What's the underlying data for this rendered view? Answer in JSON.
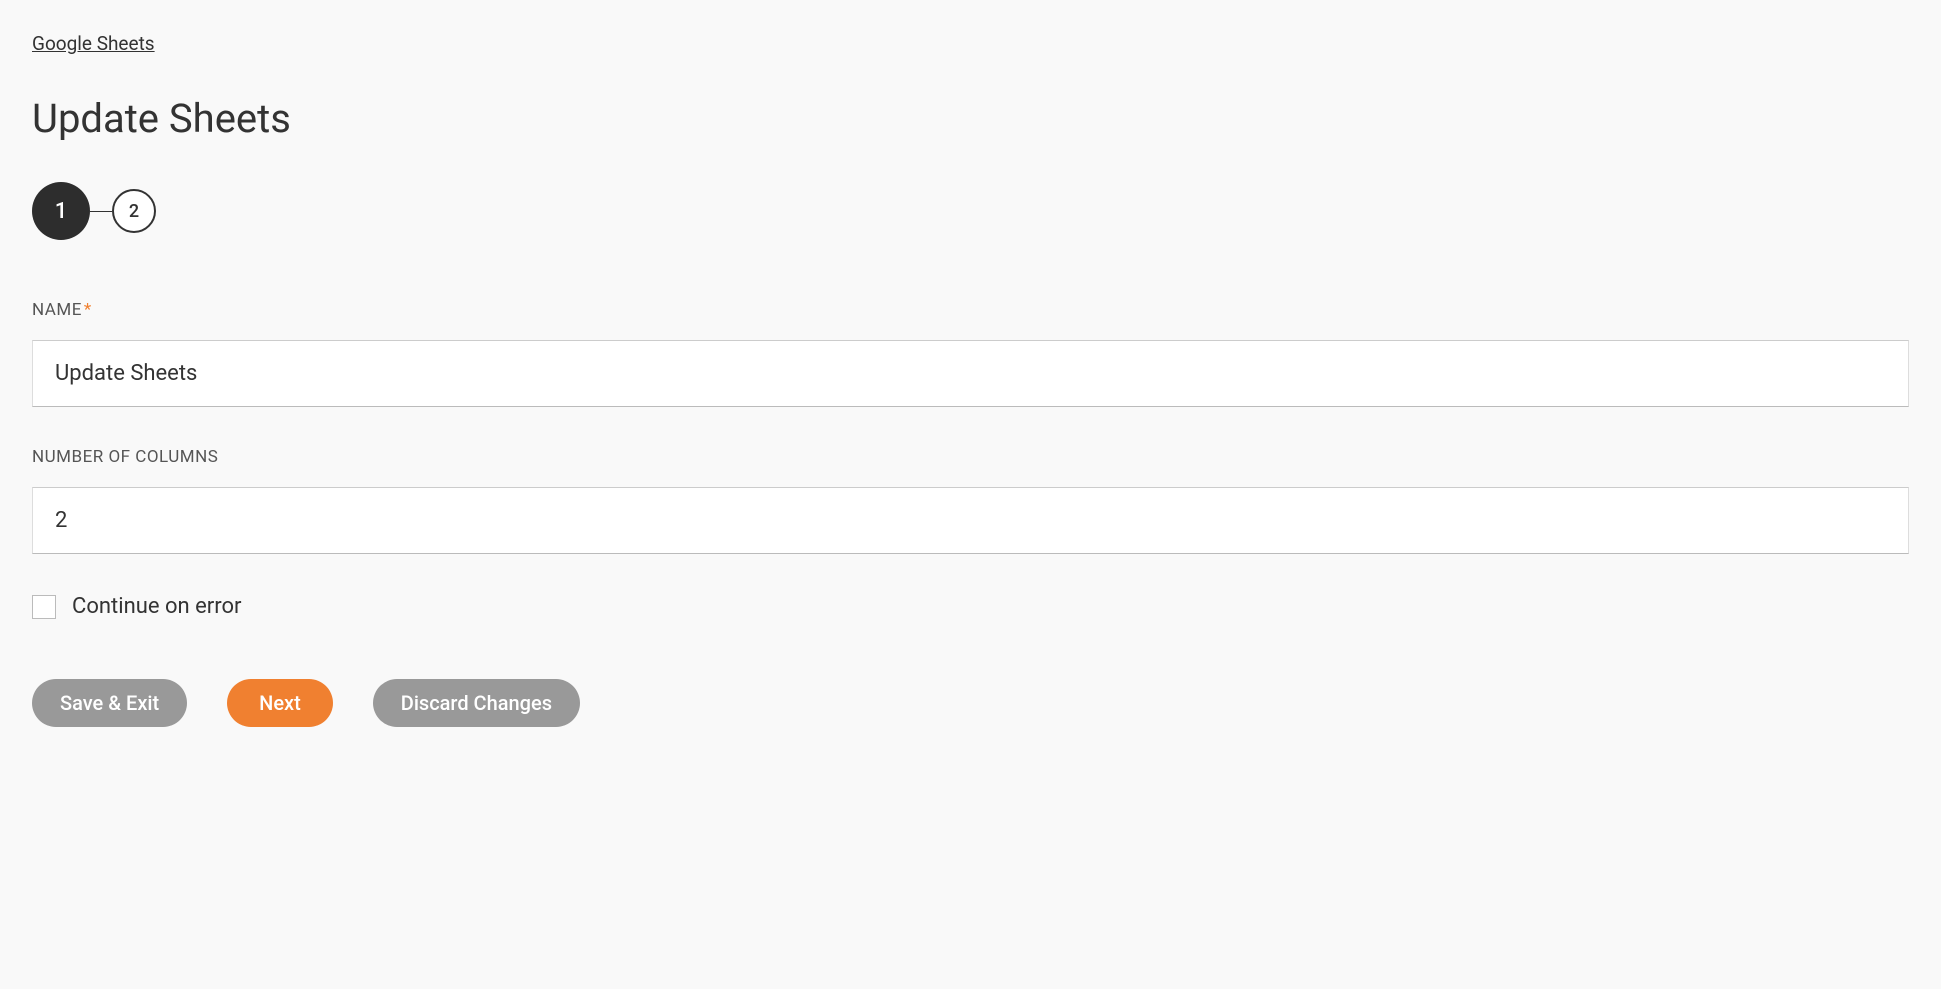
{
  "breadcrumb": {
    "label": "Google Sheets"
  },
  "page": {
    "title": "Update Sheets"
  },
  "stepper": {
    "steps": [
      {
        "number": "1",
        "active": true
      },
      {
        "number": "2",
        "active": false
      }
    ]
  },
  "form": {
    "name": {
      "label": "NAME",
      "required": true,
      "value": "Update Sheets"
    },
    "columns": {
      "label": "NUMBER OF COLUMNS",
      "value": "2"
    },
    "continueOnError": {
      "label": "Continue on error",
      "checked": false
    }
  },
  "buttons": {
    "saveExit": "Save & Exit",
    "next": "Next",
    "discard": "Discard Changes"
  }
}
